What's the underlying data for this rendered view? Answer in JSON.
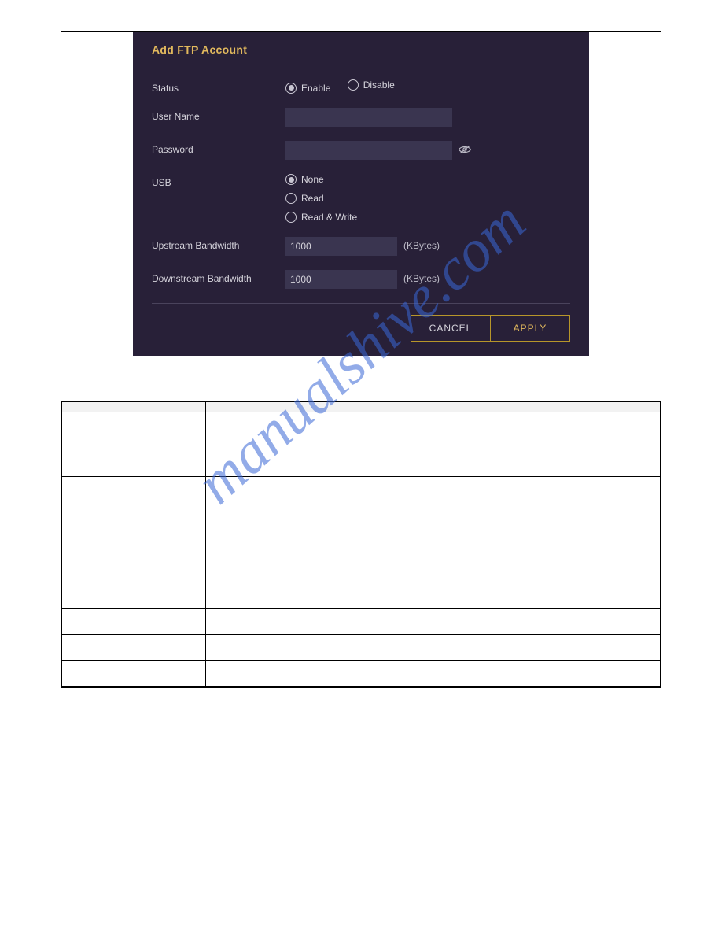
{
  "page": {
    "watermark": "manualshive.com"
  },
  "dialog": {
    "title": "Add FTP Account",
    "status": {
      "label": "Status",
      "enable": "Enable",
      "disable": "Disable"
    },
    "username": {
      "label": "User Name",
      "value": ""
    },
    "password": {
      "label": "Password",
      "value": ""
    },
    "usb": {
      "label": "USB",
      "none": "None",
      "read": "Read",
      "rw": "Read & Write"
    },
    "upstream": {
      "label": "Upstream Bandwidth",
      "value": "1000",
      "unit": "(KBytes)"
    },
    "downstream": {
      "label": "Downstream Bandwidth",
      "value": "1000",
      "unit": "(KBytes)"
    },
    "buttons": {
      "cancel": "CANCEL",
      "apply": "APPLY"
    }
  },
  "table": {
    "headers": {
      "param": "",
      "desc": ""
    },
    "rows": [
      {
        "param": "",
        "desc": ""
      },
      {
        "param": "",
        "desc": ""
      },
      {
        "param": "",
        "desc": ""
      },
      {
        "param": "",
        "desc": ""
      },
      {
        "param": "",
        "desc": ""
      },
      {
        "param": "",
        "desc": ""
      },
      {
        "param": "",
        "desc": ""
      }
    ]
  }
}
